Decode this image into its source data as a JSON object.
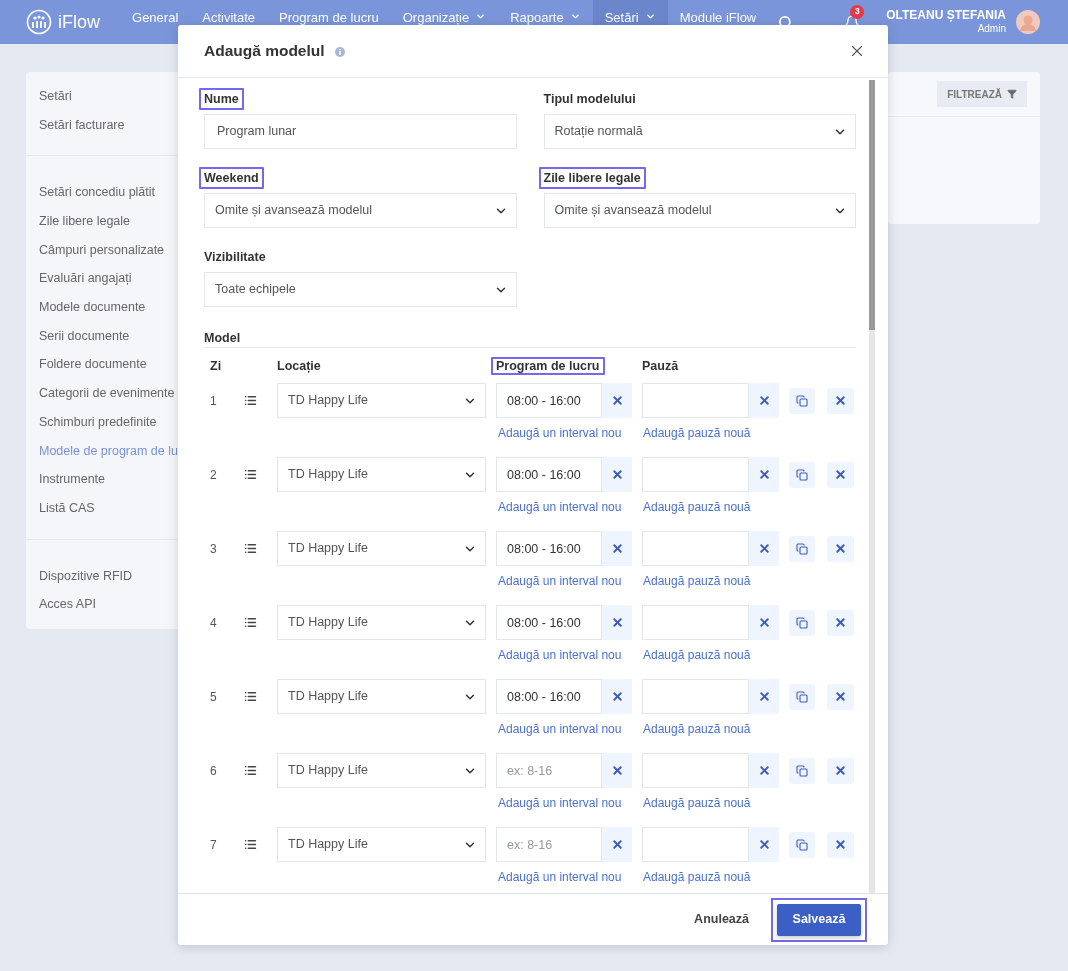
{
  "nav": {
    "logo": "iFlow",
    "items": [
      {
        "label": "General",
        "selected": false,
        "dropdown": false
      },
      {
        "label": "Activitate",
        "selected": false,
        "dropdown": false
      },
      {
        "label": "Program de lucru",
        "selected": false,
        "dropdown": false
      },
      {
        "label": "Organizație",
        "selected": false,
        "dropdown": true
      },
      {
        "label": "Rapoarte",
        "selected": false,
        "dropdown": true
      },
      {
        "label": "Setări",
        "selected": true,
        "dropdown": true
      },
      {
        "label": "Module iFlow",
        "selected": false,
        "dropdown": false
      }
    ],
    "notification_count": "3",
    "user_name": "OLTEANU ȘTEFANIA",
    "user_role": "Admin"
  },
  "sidebar": {
    "groups": [
      [
        {
          "label": "Setări",
          "selected": false
        },
        {
          "label": "Setări facturare",
          "selected": false
        }
      ],
      [
        {
          "label": "Setări concediu plătit",
          "selected": false
        },
        {
          "label": "Zile libere legale",
          "selected": false
        },
        {
          "label": "Câmpuri personalizate",
          "selected": false
        },
        {
          "label": "Evaluări angajați",
          "selected": false
        },
        {
          "label": "Modele documente",
          "selected": false
        },
        {
          "label": "Serii documente",
          "selected": false
        },
        {
          "label": "Foldere documente",
          "selected": false
        },
        {
          "label": "Categorii de evenimente",
          "selected": false
        },
        {
          "label": "Schimburi predefinite",
          "selected": false
        },
        {
          "label": "Modele de program de lu",
          "selected": true
        },
        {
          "label": "Instrumente",
          "selected": false
        },
        {
          "label": "Listă CAS",
          "selected": false
        }
      ],
      [
        {
          "label": "Dispozitive RFID",
          "selected": false
        },
        {
          "label": "Acces API",
          "selected": false
        }
      ]
    ]
  },
  "filter_button": "FILTREAZĂ",
  "modal": {
    "title": "Adaugă modelul",
    "fields": [
      {
        "label": "Nume",
        "kind": "text",
        "value": "Program lunar",
        "highlighted": true
      },
      {
        "label": "Tipul modelului",
        "kind": "select",
        "value": "Rotație normală",
        "highlighted": false
      },
      {
        "label": "Weekend",
        "kind": "select",
        "value": "Omite și avansează modelul",
        "highlighted": true
      },
      {
        "label": "Zile libere legale",
        "kind": "select",
        "value": "Omite și avansează modelul",
        "highlighted": true
      },
      {
        "label": "Vizibilitate",
        "kind": "select",
        "value": "Toate echipele",
        "highlighted": false
      }
    ],
    "model_heading": "Model",
    "columns": [
      {
        "label": "Zi",
        "highlighted": false
      },
      {
        "label": "Locație",
        "highlighted": false
      },
      {
        "label": "Program de lucru",
        "highlighted": true
      },
      {
        "label": "Pauză",
        "highlighted": false
      }
    ],
    "rows": [
      {
        "day": "1",
        "location": "TD Happy Life",
        "program": "08:00 - 16:00",
        "interval_link": "Adaugă un interval nou",
        "pause_link": "Adaugă pauză nouă"
      },
      {
        "day": "2",
        "location": "TD Happy Life",
        "program": "08:00 - 16:00",
        "interval_link": "Adaugă un interval nou",
        "pause_link": "Adaugă pauză nouă"
      },
      {
        "day": "3",
        "location": "TD Happy Life",
        "program": "08:00 - 16:00",
        "interval_link": "Adaugă un interval nou",
        "pause_link": "Adaugă pauză nouă"
      },
      {
        "day": "4",
        "location": "TD Happy Life",
        "program": "08:00 - 16:00",
        "interval_link": "Adaugă un interval nou",
        "pause_link": "Adaugă pauză nouă"
      },
      {
        "day": "5",
        "location": "TD Happy Life",
        "program": "08:00 - 16:00",
        "interval_link": "Adaugă un interval nou",
        "pause_link": "Adaugă pauză nouă"
      },
      {
        "day": "6",
        "location": "TD Happy Life",
        "program_placeholder": "ex: 8-16",
        "interval_link": "Adaugă un interval nou",
        "pause_link": "Adaugă pauză nouă"
      },
      {
        "day": "7",
        "location": "TD Happy Life",
        "program_placeholder": "ex: 8-16",
        "interval_link": "Adaugă un interval nou",
        "pause_link": "Adaugă pauză nouă"
      }
    ],
    "cancel": "Anulează",
    "save": {
      "label": "Salvează",
      "highlighted": true
    }
  }
}
